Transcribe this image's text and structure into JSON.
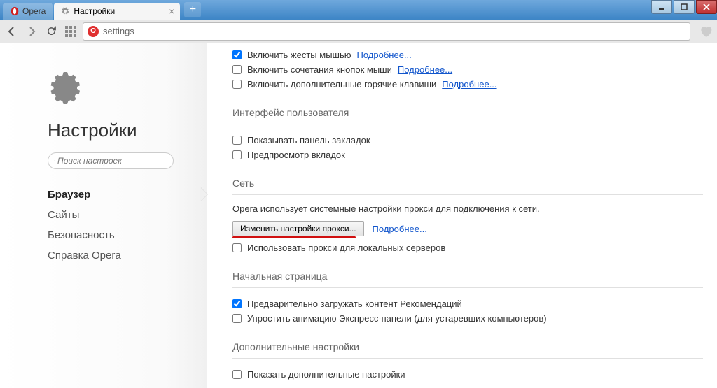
{
  "window": {
    "app_tab": "Opera",
    "page_tab": "Настройки"
  },
  "toolbar": {
    "address": "settings"
  },
  "sidebar": {
    "title": "Настройки",
    "search_placeholder": "Поиск настроек",
    "items": [
      {
        "label": "Браузер",
        "active": true
      },
      {
        "label": "Сайты"
      },
      {
        "label": "Безопасность"
      },
      {
        "label": "Справка Opera"
      }
    ]
  },
  "settings": {
    "mouse_gestures": {
      "label": "Включить жесты мышью",
      "more": "Подробнее..."
    },
    "rocker": {
      "label": "Включить сочетания кнопок мыши",
      "more": "Подробнее..."
    },
    "hotkeys": {
      "label": "Включить дополнительные горячие клавиши",
      "more": "Подробнее..."
    },
    "ui_section": "Интерфейс пользователя",
    "bookmarks_bar": "Показывать панель закладок",
    "tab_preview": "Предпросмотр вкладок",
    "network_section": "Сеть",
    "network_desc": "Opera использует системные настройки прокси для подключения к сети.",
    "proxy_btn": "Изменить настройки прокси...",
    "proxy_more": "Подробнее...",
    "proxy_local": "Использовать прокси для локальных серверов",
    "startpage_section": "Начальная страница",
    "preload": "Предварительно загружать контент Рекомендаций",
    "simplify": "Упростить анимацию Экспресс-панели (для устаревших компьютеров)",
    "advanced_section": "Дополнительные настройки",
    "show_advanced": "Показать дополнительные настройки"
  }
}
